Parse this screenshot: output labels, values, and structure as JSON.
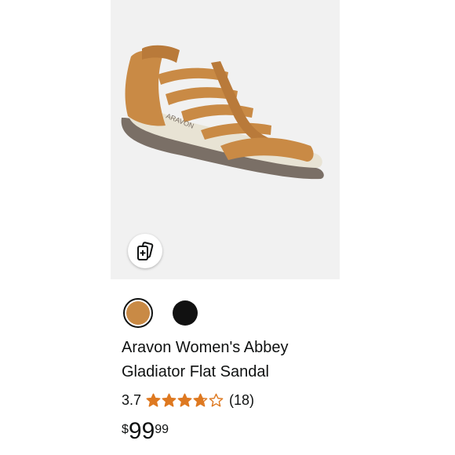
{
  "product": {
    "title": "Aravon Women's Abbey Gladiator Flat Sandal",
    "rating": "3.7",
    "rating_stars": 3.7,
    "review_count": "(18)",
    "price": {
      "symbol": "$",
      "whole": "99",
      "fraction": "99"
    }
  },
  "swatches": [
    {
      "name": "tan",
      "color": "#c98a45",
      "selected": true
    },
    {
      "name": "black",
      "color": "#111111",
      "selected": false
    }
  ],
  "colors": {
    "image_background": "#f1f1f1",
    "star": "#de7921",
    "text": "#0f1111"
  },
  "icons": {
    "compare": "compare-cards-plus-icon"
  }
}
